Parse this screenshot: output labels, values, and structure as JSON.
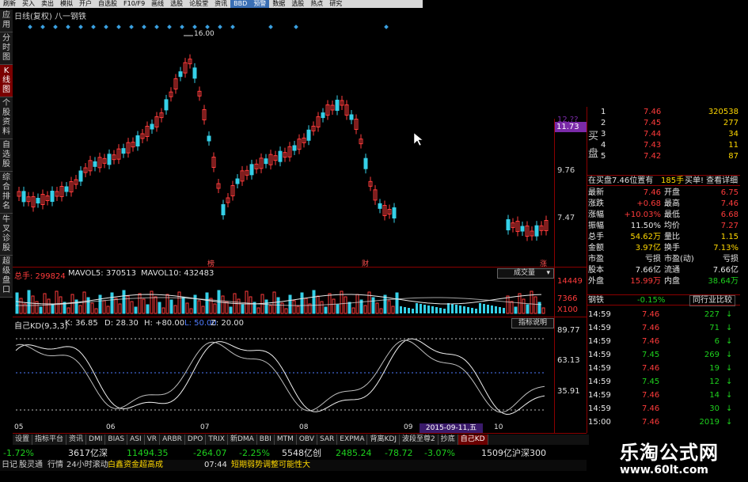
{
  "menu": [
    "刷新",
    "买入",
    "卖出",
    "模拟",
    "开户",
    "自选股",
    "F10/F9",
    "画线",
    "选股",
    "论股堂",
    "资讯",
    "BBD",
    "预警",
    "数据",
    "选股",
    "热点",
    "研究"
  ],
  "nav": [
    "应用",
    "分时图",
    "K线图",
    "个股资料",
    "自选股",
    "综合排名",
    "牛叉诊股",
    "超级盘口"
  ],
  "chart": {
    "title": "日线(复权) 八一钢铁",
    "peak_label": "16.00",
    "price_ticks": [
      "11.73",
      "9.76",
      "7.47",
      "12.??"
    ],
    "price_tag": "11.73",
    "markers": [
      "榜",
      "财",
      "涨"
    ],
    "volume": {
      "total_label": "总手: 299824",
      "mavol5_label": "MAVOL5: 370513",
      "mavol10_label": "MAVOL10: 432483",
      "dropdown": "成交量",
      "ticks": [
        "14449",
        "7366",
        "X100"
      ]
    },
    "kd": {
      "title": "自己KD(9,3,3)",
      "k_label": "K: 36.85",
      "d_label": "D: 28.30",
      "h_label": "H: +80.00",
      "l_label": "L: 50.00",
      "z_label": "Z: 20.00",
      "button": "指标说明",
      "ticks": [
        "89.77",
        "63.13",
        "35.91"
      ]
    },
    "xaxis": [
      "05",
      "06",
      "07",
      "08",
      "09",
      "10"
    ],
    "date_tag": "2015-09-11,五"
  },
  "quote": {
    "buy_label": "买",
    "plate_label": "盘",
    "buy_levels": [
      {
        "level": "1",
        "price": "7.46",
        "vol": "320538"
      },
      {
        "level": "2",
        "price": "7.45",
        "vol": "277"
      },
      {
        "level": "3",
        "price": "7.44",
        "vol": "34"
      },
      {
        "level": "4",
        "price": "7.43",
        "vol": "11"
      },
      {
        "level": "5",
        "price": "7.42",
        "vol": "87"
      }
    ],
    "queue_text": "在买盘7.46位置有",
    "queue_count": "185手",
    "queue_action": "买单! 查看详细",
    "stats_left": [
      {
        "label": "最新",
        "value": "7.46"
      },
      {
        "label": "涨跌",
        "value": "+0.68"
      },
      {
        "label": "涨幅",
        "value": "+10.03%"
      },
      {
        "label": "振幅",
        "value": "11.50%"
      },
      {
        "label": "总手",
        "value": "54.62万"
      },
      {
        "label": "金额",
        "value": "3.97亿"
      },
      {
        "label": "市盈",
        "value": "亏损"
      },
      {
        "label": "股本",
        "value": "7.66亿"
      },
      {
        "label": "外盘",
        "value": "15.99万"
      }
    ],
    "stats_right": [
      {
        "label": "开盘",
        "value": "6.75"
      },
      {
        "label": "最高",
        "value": "7.46"
      },
      {
        "label": "最低",
        "value": "6.68"
      },
      {
        "label": "均价",
        "value": "7.27"
      },
      {
        "label": "量比",
        "value": "1.15"
      },
      {
        "label": "换手",
        "value": "7.13%"
      },
      {
        "label": "市盈(动)",
        "value": "亏损"
      },
      {
        "label": "流通",
        "value": "7.66亿"
      },
      {
        "label": "内盘",
        "value": "38.64万"
      }
    ],
    "sector_name": "钢铁",
    "sector_change": "-0.15%",
    "sector_button": "同行业比较",
    "ticks": [
      {
        "time": "14:59",
        "price": "7.46",
        "vol": "227"
      },
      {
        "time": "14:59",
        "price": "7.46",
        "vol": "71"
      },
      {
        "time": "14:59",
        "price": "7.46",
        "vol": "6"
      },
      {
        "time": "14:59",
        "price": "7.45",
        "vol": "269"
      },
      {
        "time": "14:59",
        "price": "7.46",
        "vol": "19"
      },
      {
        "time": "14:59",
        "price": "7.45",
        "vol": "12"
      },
      {
        "time": "14:59",
        "price": "7.46",
        "vol": "14"
      },
      {
        "time": "14:59",
        "price": "7.46",
        "vol": "30"
      },
      {
        "time": "15:00",
        "price": "7.46",
        "vol": "2019"
      }
    ]
  },
  "tabs": [
    "设置",
    "指标平台",
    "资讯",
    "DMI",
    "BIAS",
    "ASI",
    "VR",
    "ARBR",
    "DPO",
    "TRIX",
    "新DMA",
    "BBI",
    "MTM",
    "OBV",
    "SAR",
    "EXPMA",
    "背离KDJ",
    "波段至尊2",
    "抄底",
    "自己KD"
  ],
  "status": {
    "sh_change": "-1.72%",
    "sh_amount": "3617亿深",
    "sz_index": "11494.35",
    "sz_change": "-264.07",
    "sz_pct": "-2.25%",
    "cy_amount": "5548亿创",
    "cy_index": "2485.24",
    "cy_change": "-78.72",
    "cy_pct": "-3.07%",
    "total": "1509亿沪深300",
    "bar2_items": [
      "日记",
      "股灵通",
      "行情",
      "24小时滚动",
      "白鑫资金超高成"
    ],
    "bar2_time": "07:44",
    "bar2_news": "短期弱势调整可能性大"
  },
  "brand": {
    "title": "乐淘公式网",
    "url": "www.60lt.com"
  },
  "colors": {
    "up": "#ff3b3b",
    "down": "#35d0e8",
    "axis": "#8b0000",
    "accent_purple": "#7a2aa8"
  }
}
